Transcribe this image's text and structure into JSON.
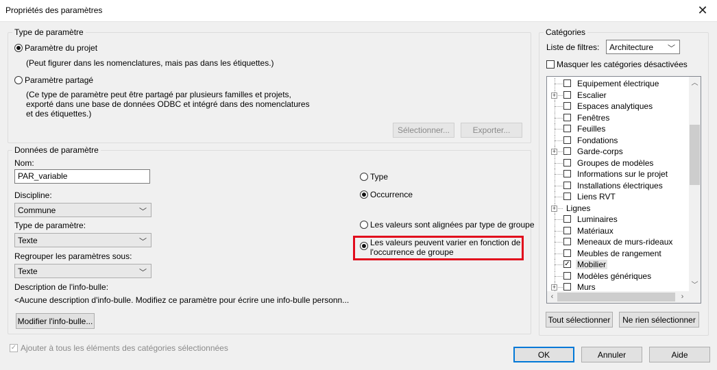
{
  "window": {
    "title": "Propriétés des paramètres",
    "close_icon": "close-icon"
  },
  "param_type_group": {
    "title": "Type de paramètre",
    "project": {
      "label": "Paramètre du projet",
      "selected": true,
      "desc": "(Peut figurer dans les nomenclatures, mais pas dans les étiquettes.)"
    },
    "shared": {
      "label": "Paramètre partagé",
      "selected": false,
      "desc_lines": [
        "(Ce type de paramètre peut être partagé par plusieurs familles et projets,",
        "exporté dans une base de données ODBC et intégré dans des nomenclatures",
        "et des étiquettes.)"
      ]
    },
    "select_button": "Sélectionner...",
    "export_button": "Exporter..."
  },
  "param_data_group": {
    "title": "Données de paramètre",
    "name_label": "Nom:",
    "name_value": "PAR_variable",
    "discipline_label": "Discipline:",
    "discipline_value": "Commune",
    "type_label": "Type de paramètre:",
    "type_value": "Texte",
    "group_label": "Regrouper les paramètres sous:",
    "group_value": "Texte",
    "tooltip_label": "Description de l'info-bulle:",
    "tooltip_value": "<Aucune description d'info-bulle. Modifiez ce paramètre pour écrire une info-bulle personn...",
    "edit_tooltip_button": "Modifier l'info-bulle...",
    "radio_type": {
      "label": "Type",
      "selected": false
    },
    "radio_instance": {
      "label": "Occurrence",
      "selected": true
    },
    "radio_aligned": {
      "label": "Les valeurs sont alignées par type de groupe",
      "selected": false
    },
    "radio_vary": {
      "label_lines": [
        "Les valeurs peuvent varier en fonction de",
        "l'occurrence de groupe"
      ],
      "selected": true
    },
    "highlight_color": "#e10b1c"
  },
  "categories": {
    "title": "Catégories",
    "filter_label": "Liste de filtres:",
    "filter_value": "Architecture",
    "hide_disabled_label": "Masquer les catégories désactivées",
    "items": [
      {
        "label": "Equipement électrique",
        "expandable": false,
        "checkbox": true,
        "checked": false
      },
      {
        "label": "Escalier",
        "expandable": true,
        "checkbox": true,
        "checked": false
      },
      {
        "label": "Espaces analytiques",
        "expandable": false,
        "checkbox": true,
        "checked": false
      },
      {
        "label": "Fenêtres",
        "expandable": false,
        "checkbox": true,
        "checked": false
      },
      {
        "label": "Feuilles",
        "expandable": false,
        "checkbox": true,
        "checked": false
      },
      {
        "label": "Fondations",
        "expandable": false,
        "checkbox": true,
        "checked": false
      },
      {
        "label": "Garde-corps",
        "expandable": true,
        "checkbox": true,
        "checked": false
      },
      {
        "label": "Groupes de modèles",
        "expandable": false,
        "checkbox": true,
        "checked": false
      },
      {
        "label": "Informations sur le projet",
        "expandable": false,
        "checkbox": true,
        "checked": false
      },
      {
        "label": "Installations électriques",
        "expandable": false,
        "checkbox": true,
        "checked": false
      },
      {
        "label": "Liens RVT",
        "expandable": false,
        "checkbox": true,
        "checked": false
      },
      {
        "label": "Lignes",
        "expandable": true,
        "checkbox": false,
        "checked": false
      },
      {
        "label": "Luminaires",
        "expandable": false,
        "checkbox": true,
        "checked": false
      },
      {
        "label": "Matériaux",
        "expandable": false,
        "checkbox": true,
        "checked": false
      },
      {
        "label": "Meneaux de murs-rideaux",
        "expandable": false,
        "checkbox": true,
        "checked": false
      },
      {
        "label": "Meubles de rangement",
        "expandable": false,
        "checkbox": true,
        "checked": false
      },
      {
        "label": "Mobilier",
        "expandable": false,
        "checkbox": true,
        "checked": true,
        "selected": true
      },
      {
        "label": "Modèles génériques",
        "expandable": false,
        "checkbox": true,
        "checked": false
      },
      {
        "label": "Murs",
        "expandable": true,
        "checkbox": true,
        "checked": false
      }
    ],
    "select_all_button": "Tout sélectionner",
    "select_none_button": "Ne rien sélectionner"
  },
  "footer": {
    "add_to_all_label": "Ajouter à tous les éléments des catégories sélectionnées",
    "ok_button": "OK",
    "cancel_button": "Annuler",
    "help_button": "Aide"
  }
}
